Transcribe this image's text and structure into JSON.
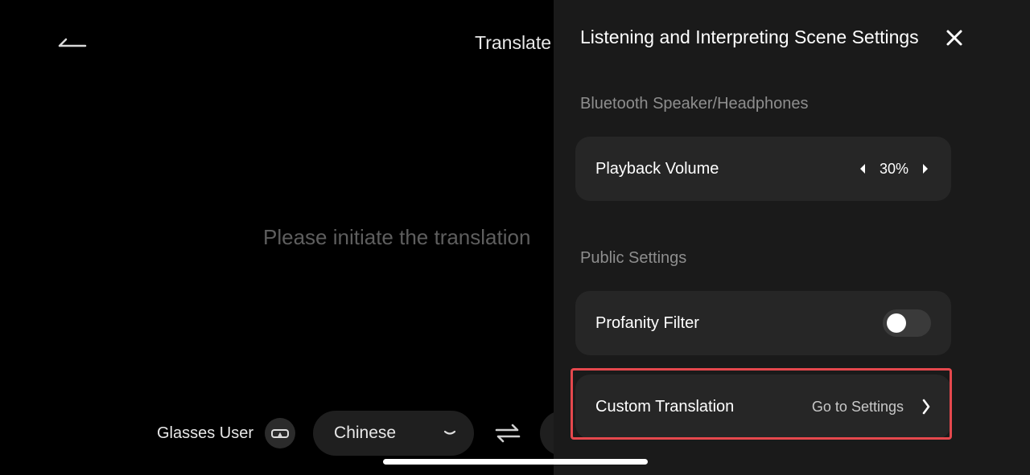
{
  "background": {
    "title": "Translate",
    "prompt": "Please initiate the translation",
    "user_label": "Glasses User",
    "source_language": "Chinese"
  },
  "panel": {
    "title": "Listening and Interpreting Scene Settings",
    "sections": {
      "bluetooth": {
        "label": "Bluetooth Speaker/Headphones",
        "playback_volume": {
          "label": "Playback Volume",
          "value": "30%"
        }
      },
      "public": {
        "label": "Public Settings",
        "profanity_filter": {
          "label": "Profanity Filter",
          "enabled": false
        },
        "custom_translation": {
          "label": "Custom Translation",
          "action": "Go to Settings"
        }
      }
    }
  },
  "colors": {
    "panel_bg": "#1a1a1a",
    "card_bg": "#262626",
    "highlight": "#e5484d"
  },
  "icons": [
    "back-arrow-icon",
    "glasses-icon",
    "chevron-down-icon",
    "swap-icon",
    "close-icon",
    "caret-left-icon",
    "caret-right-icon",
    "chevron-right-icon"
  ]
}
